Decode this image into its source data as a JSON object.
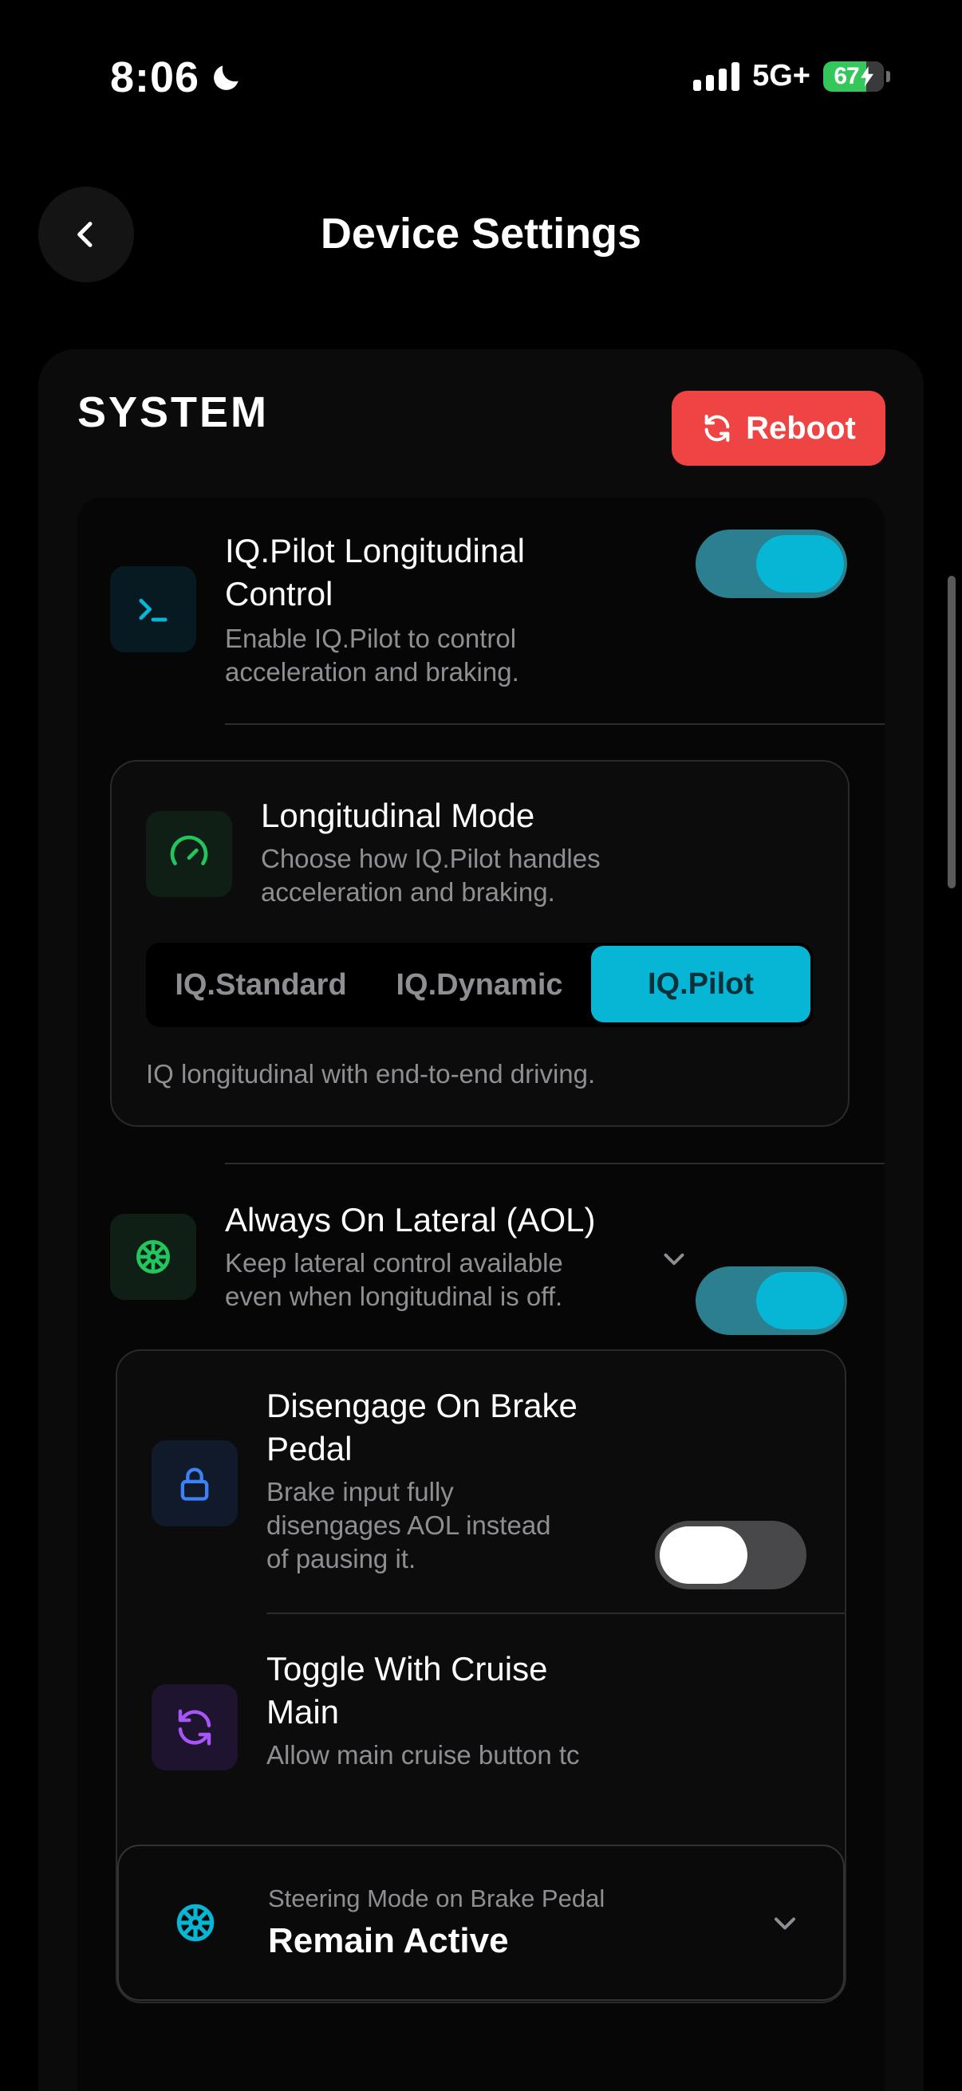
{
  "status_bar": {
    "time": "8:06",
    "network": "5G+",
    "battery": "67"
  },
  "header": {
    "title": "Device Settings"
  },
  "system": {
    "section_title": "SYSTEM",
    "reboot_label": "Reboot",
    "longitudinal_control": {
      "title_line1": "IQ.Pilot Longitudinal",
      "title_line2": "Control",
      "desc_line1": "Enable IQ.Pilot to control",
      "desc_line2": "acceleration and braking.",
      "enabled": true
    },
    "longitudinal_mode": {
      "title": "Longitudinal Mode",
      "desc_line1": "Choose how IQ.Pilot handles",
      "desc_line2": "acceleration and braking.",
      "options": [
        "IQ.Standard",
        "IQ.Dynamic",
        "IQ.Pilot"
      ],
      "selected": "IQ.Pilot",
      "selected_desc": "IQ longitudinal with end-to-end driving."
    },
    "aol": {
      "title": "Always On Lateral (AOL)",
      "desc_line1": "Keep lateral control available",
      "desc_line2": "even when longitudinal is off.",
      "enabled": true
    },
    "disengage_brake": {
      "title_line1": "Disengage On Brake",
      "title_line2": "Pedal",
      "desc_line1": "Brake input fully",
      "desc_line2": "disengages AOL instead",
      "desc_line3": "of pausing it.",
      "enabled": false
    },
    "toggle_cruise": {
      "title_line1": "Toggle With Cruise",
      "title_line2": "Main",
      "desc_line1": "Allow main cruise button tc",
      "enabled": true
    },
    "steering_mode": {
      "label": "Steering Mode on Brake Pedal",
      "value": "Remain Active"
    }
  },
  "colors": {
    "accent": "#06b6d4",
    "danger": "#ef4444",
    "green": "#22c55e",
    "blue": "#3b82f6",
    "purple": "#a855f7"
  }
}
